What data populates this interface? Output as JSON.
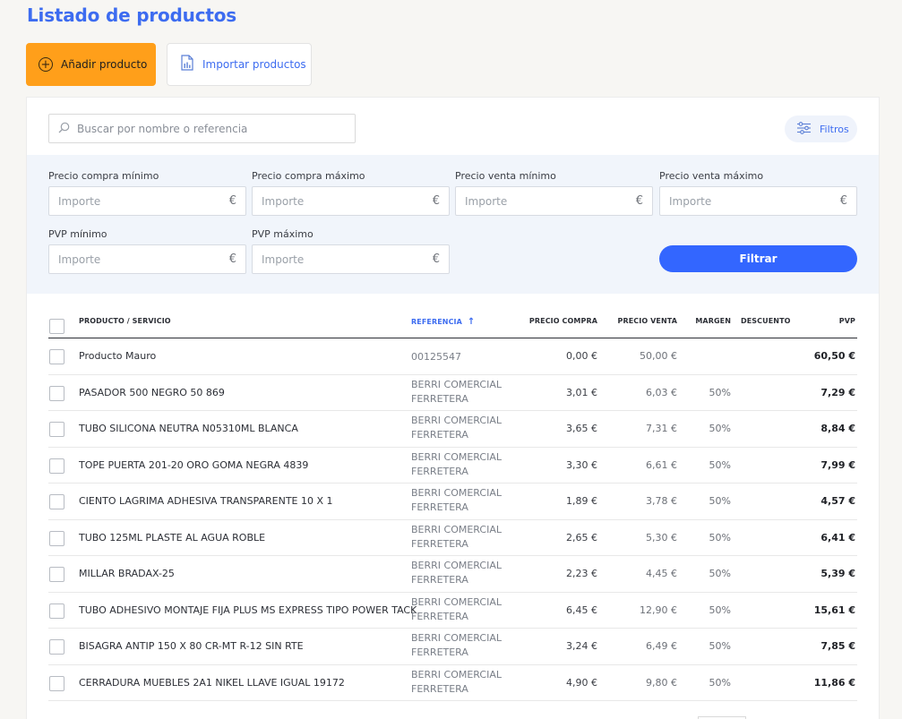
{
  "page": {
    "title": "Listado de productos"
  },
  "actions": {
    "add_label": "Añadir producto",
    "add_symbol": "+",
    "import_label": "Importar productos"
  },
  "search": {
    "placeholder": "Buscar por nombre o referencia"
  },
  "filters_button": {
    "label": "Filtros"
  },
  "filters": {
    "precio_compra_min": {
      "label": "Precio compra mínimo",
      "placeholder": "Importe",
      "currency": "€"
    },
    "precio_compra_max": {
      "label": "Precio compra máximo",
      "placeholder": "Importe",
      "currency": "€"
    },
    "precio_venta_min": {
      "label": "Precio venta mínimo",
      "placeholder": "Importe",
      "currency": "€"
    },
    "precio_venta_max": {
      "label": "Precio venta máximo",
      "placeholder": "Importe",
      "currency": "€"
    },
    "pvp_min": {
      "label": "PVP mínimo",
      "placeholder": "Importe",
      "currency": "€"
    },
    "pvp_max": {
      "label": "PVP máximo",
      "placeholder": "Importe",
      "currency": "€"
    },
    "apply_label": "Filtrar"
  },
  "table": {
    "columns": {
      "producto": "PRODUCTO / SERVICIO",
      "referencia": "REFERENCIA",
      "precio_compra": "PRECIO COMPRA",
      "precio_venta": "PRECIO VENTA",
      "margen": "MARGEN",
      "descuento": "DESCUENTO",
      "pvp": "PVP"
    },
    "sort_indicator": "↑",
    "rows": [
      {
        "producto": "Producto Mauro",
        "referencia": "00125547",
        "precio_compra": "0,00 €",
        "precio_venta": "50,00 €",
        "margen": "",
        "descuento": "",
        "pvp": "60,50 €"
      },
      {
        "producto": "PASADOR 500 NEGRO 50 869",
        "referencia": "BERRI COMERCIAL FERRETERA",
        "precio_compra": "3,01 €",
        "precio_venta": "6,03 €",
        "margen": "50%",
        "descuento": "",
        "pvp": "7,29 €"
      },
      {
        "producto": "TUBO SILICONA NEUTRA N05310ML BLANCA",
        "referencia": "BERRI COMERCIAL FERRETERA",
        "precio_compra": "3,65 €",
        "precio_venta": "7,31 €",
        "margen": "50%",
        "descuento": "",
        "pvp": "8,84 €"
      },
      {
        "producto": "TOPE PUERTA 201-20 ORO GOMA NEGRA 4839",
        "referencia": "BERRI COMERCIAL FERRETERA",
        "precio_compra": "3,30 €",
        "precio_venta": "6,61 €",
        "margen": "50%",
        "descuento": "",
        "pvp": "7,99 €"
      },
      {
        "producto": "CIENTO LAGRIMA ADHESIVA TRANSPARENTE 10 X 1",
        "referencia": "BERRI COMERCIAL FERRETERA",
        "precio_compra": "1,89 €",
        "precio_venta": "3,78 €",
        "margen": "50%",
        "descuento": "",
        "pvp": "4,57 €"
      },
      {
        "producto": "TUBO 125ML PLASTE AL AGUA ROBLE",
        "referencia": "BERRI COMERCIAL FERRETERA",
        "precio_compra": "2,65 €",
        "precio_venta": "5,30 €",
        "margen": "50%",
        "descuento": "",
        "pvp": "6,41 €"
      },
      {
        "producto": "MILLAR BRADAX-25",
        "referencia": "BERRI COMERCIAL FERRETERA",
        "precio_compra": "2,23 €",
        "precio_venta": "4,45 €",
        "margen": "50%",
        "descuento": "",
        "pvp": "5,39 €"
      },
      {
        "producto": "TUBO ADHESIVO MONTAJE FIJA PLUS MS EXPRESS TIPO POWER TACK",
        "referencia": "BERRI COMERCIAL FERRETERA",
        "precio_compra": "6,45 €",
        "precio_venta": "12,90 €",
        "margen": "50%",
        "descuento": "",
        "pvp": "15,61 €"
      },
      {
        "producto": "BISAGRA ANTIP 150 X 80 CR-MT R-12 SIN RTE",
        "referencia": "BERRI COMERCIAL FERRETERA",
        "precio_compra": "3,24 €",
        "precio_venta": "6,49 €",
        "margen": "50%",
        "descuento": "",
        "pvp": "7,85 €"
      },
      {
        "producto": "CERRADURA MUEBLES 2A1 NIKEL LLAVE IGUAL 19172",
        "referencia": "BERRI COMERCIAL FERRETERA",
        "precio_compra": "4,90 €",
        "precio_venta": "9,80 €",
        "margen": "50%",
        "descuento": "",
        "pvp": "11,86 €"
      }
    ]
  },
  "colors": {
    "accent": "#3d6cf0",
    "primary_button": "#3366ff",
    "add_button": "#ff9f1a",
    "filter_panel": "#f1f5fb"
  },
  "icons": {
    "add": "plus-circle-icon",
    "import": "spreadsheet-icon",
    "search": "search-icon",
    "filters": "sliders-icon",
    "sort": "arrow-up-icon"
  }
}
